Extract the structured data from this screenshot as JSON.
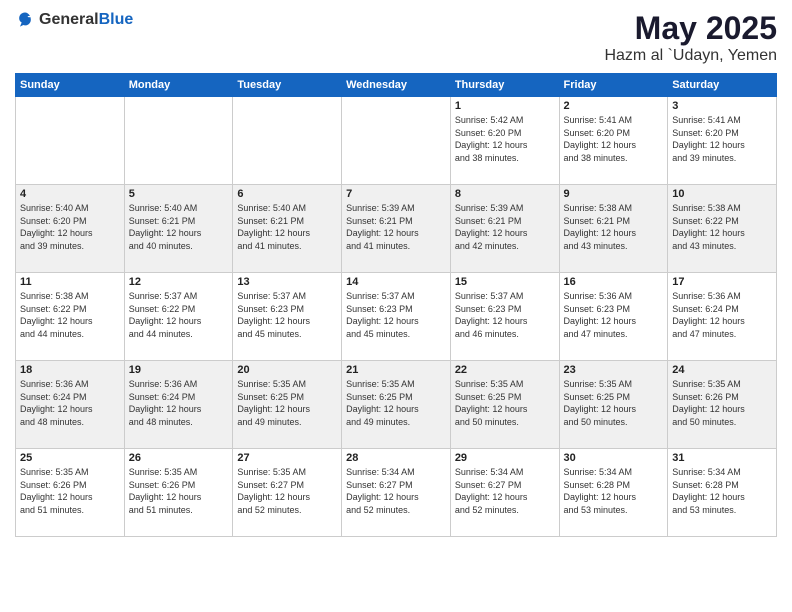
{
  "header": {
    "logo": {
      "general": "General",
      "blue": "Blue"
    },
    "title": "May 2025",
    "subtitle": "Hazm al `Udayn, Yemen"
  },
  "weekdays": [
    "Sunday",
    "Monday",
    "Tuesday",
    "Wednesday",
    "Thursday",
    "Friday",
    "Saturday"
  ],
  "weeks": [
    [
      {
        "day": "",
        "info": ""
      },
      {
        "day": "",
        "info": ""
      },
      {
        "day": "",
        "info": ""
      },
      {
        "day": "",
        "info": ""
      },
      {
        "day": "1",
        "info": "Sunrise: 5:42 AM\nSunset: 6:20 PM\nDaylight: 12 hours\nand 38 minutes."
      },
      {
        "day": "2",
        "info": "Sunrise: 5:41 AM\nSunset: 6:20 PM\nDaylight: 12 hours\nand 38 minutes."
      },
      {
        "day": "3",
        "info": "Sunrise: 5:41 AM\nSunset: 6:20 PM\nDaylight: 12 hours\nand 39 minutes."
      }
    ],
    [
      {
        "day": "4",
        "info": "Sunrise: 5:40 AM\nSunset: 6:20 PM\nDaylight: 12 hours\nand 39 minutes."
      },
      {
        "day": "5",
        "info": "Sunrise: 5:40 AM\nSunset: 6:21 PM\nDaylight: 12 hours\nand 40 minutes."
      },
      {
        "day": "6",
        "info": "Sunrise: 5:40 AM\nSunset: 6:21 PM\nDaylight: 12 hours\nand 41 minutes."
      },
      {
        "day": "7",
        "info": "Sunrise: 5:39 AM\nSunset: 6:21 PM\nDaylight: 12 hours\nand 41 minutes."
      },
      {
        "day": "8",
        "info": "Sunrise: 5:39 AM\nSunset: 6:21 PM\nDaylight: 12 hours\nand 42 minutes."
      },
      {
        "day": "9",
        "info": "Sunrise: 5:38 AM\nSunset: 6:21 PM\nDaylight: 12 hours\nand 43 minutes."
      },
      {
        "day": "10",
        "info": "Sunrise: 5:38 AM\nSunset: 6:22 PM\nDaylight: 12 hours\nand 43 minutes."
      }
    ],
    [
      {
        "day": "11",
        "info": "Sunrise: 5:38 AM\nSunset: 6:22 PM\nDaylight: 12 hours\nand 44 minutes."
      },
      {
        "day": "12",
        "info": "Sunrise: 5:37 AM\nSunset: 6:22 PM\nDaylight: 12 hours\nand 44 minutes."
      },
      {
        "day": "13",
        "info": "Sunrise: 5:37 AM\nSunset: 6:23 PM\nDaylight: 12 hours\nand 45 minutes."
      },
      {
        "day": "14",
        "info": "Sunrise: 5:37 AM\nSunset: 6:23 PM\nDaylight: 12 hours\nand 45 minutes."
      },
      {
        "day": "15",
        "info": "Sunrise: 5:37 AM\nSunset: 6:23 PM\nDaylight: 12 hours\nand 46 minutes."
      },
      {
        "day": "16",
        "info": "Sunrise: 5:36 AM\nSunset: 6:23 PM\nDaylight: 12 hours\nand 47 minutes."
      },
      {
        "day": "17",
        "info": "Sunrise: 5:36 AM\nSunset: 6:24 PM\nDaylight: 12 hours\nand 47 minutes."
      }
    ],
    [
      {
        "day": "18",
        "info": "Sunrise: 5:36 AM\nSunset: 6:24 PM\nDaylight: 12 hours\nand 48 minutes."
      },
      {
        "day": "19",
        "info": "Sunrise: 5:36 AM\nSunset: 6:24 PM\nDaylight: 12 hours\nand 48 minutes."
      },
      {
        "day": "20",
        "info": "Sunrise: 5:35 AM\nSunset: 6:25 PM\nDaylight: 12 hours\nand 49 minutes."
      },
      {
        "day": "21",
        "info": "Sunrise: 5:35 AM\nSunset: 6:25 PM\nDaylight: 12 hours\nand 49 minutes."
      },
      {
        "day": "22",
        "info": "Sunrise: 5:35 AM\nSunset: 6:25 PM\nDaylight: 12 hours\nand 50 minutes."
      },
      {
        "day": "23",
        "info": "Sunrise: 5:35 AM\nSunset: 6:25 PM\nDaylight: 12 hours\nand 50 minutes."
      },
      {
        "day": "24",
        "info": "Sunrise: 5:35 AM\nSunset: 6:26 PM\nDaylight: 12 hours\nand 50 minutes."
      }
    ],
    [
      {
        "day": "25",
        "info": "Sunrise: 5:35 AM\nSunset: 6:26 PM\nDaylight: 12 hours\nand 51 minutes."
      },
      {
        "day": "26",
        "info": "Sunrise: 5:35 AM\nSunset: 6:26 PM\nDaylight: 12 hours\nand 51 minutes."
      },
      {
        "day": "27",
        "info": "Sunrise: 5:35 AM\nSunset: 6:27 PM\nDaylight: 12 hours\nand 52 minutes."
      },
      {
        "day": "28",
        "info": "Sunrise: 5:34 AM\nSunset: 6:27 PM\nDaylight: 12 hours\nand 52 minutes."
      },
      {
        "day": "29",
        "info": "Sunrise: 5:34 AM\nSunset: 6:27 PM\nDaylight: 12 hours\nand 52 minutes."
      },
      {
        "day": "30",
        "info": "Sunrise: 5:34 AM\nSunset: 6:28 PM\nDaylight: 12 hours\nand 53 minutes."
      },
      {
        "day": "31",
        "info": "Sunrise: 5:34 AM\nSunset: 6:28 PM\nDaylight: 12 hours\nand 53 minutes."
      }
    ]
  ]
}
